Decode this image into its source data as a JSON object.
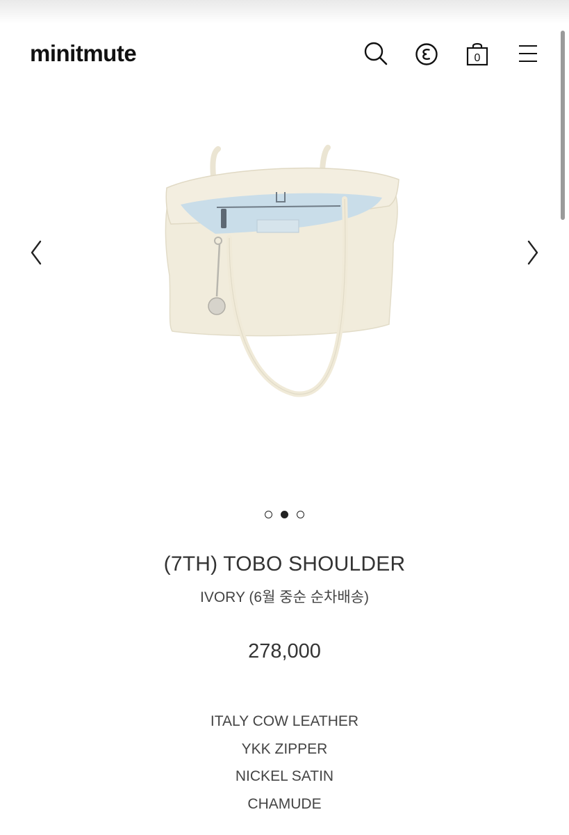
{
  "header": {
    "logo": "minitmute",
    "icons": {
      "search": "search-icon",
      "currency": "currency-icon",
      "cart": "shopping-bag-icon",
      "menu": "hamburger-menu-icon"
    },
    "cart_count": "0"
  },
  "carousel": {
    "image": "ivory-tote-bag",
    "prev_icon": "chevron-left-icon",
    "next_icon": "chevron-right-icon",
    "slide_count": 3,
    "active_slide": 2
  },
  "product": {
    "title": "(7TH) TOBO SHOULDER",
    "subtitle": "IVORY (6월 중순 순차배송)",
    "price": "278,000",
    "specs": [
      "ITALY COW LEATHER",
      "YKK ZIPPER",
      "NICKEL SATIN",
      "CHAMUDE"
    ]
  },
  "colors": {
    "text": "#333333",
    "bag": "#f1ecdc",
    "lining": "#c9dde9"
  }
}
